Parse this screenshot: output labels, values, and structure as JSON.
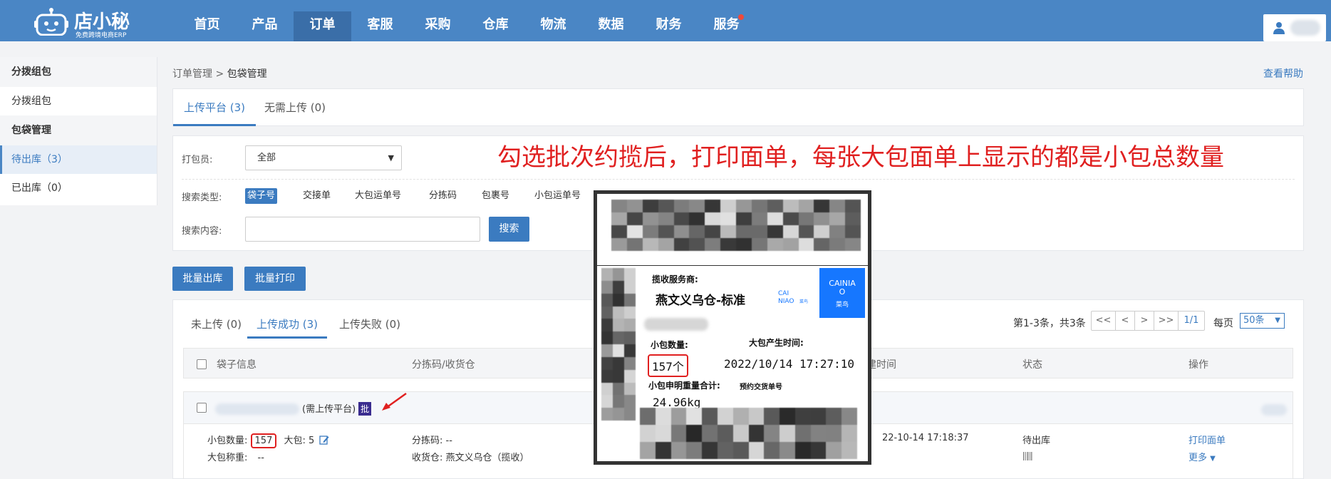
{
  "app": {
    "logo_name": "店小秘",
    "logo_sub": "免费跨境电商ERP"
  },
  "nav": {
    "items": [
      {
        "label": "首页"
      },
      {
        "label": "产品"
      },
      {
        "label": "订单",
        "active": true
      },
      {
        "label": "客服"
      },
      {
        "label": "采购"
      },
      {
        "label": "仓库"
      },
      {
        "label": "物流"
      },
      {
        "label": "数据"
      },
      {
        "label": "财务"
      },
      {
        "label": "服务",
        "dot": true
      }
    ]
  },
  "sidebar": {
    "group1": "分拨组包",
    "item1": "分拨组包",
    "group2": "包袋管理",
    "item2": "待出库（3）",
    "item3": "已出库（0）"
  },
  "breadcrumb": {
    "parent": "订单管理",
    "sep": ">",
    "current": "包袋管理"
  },
  "help": "查看帮助",
  "platform_tabs": [
    "上传平台 (3)",
    "无需上传 (0)"
  ],
  "filter": {
    "packer_label": "打包员:",
    "packer_value": "全部",
    "search_type_label": "搜索类型:",
    "search_types": [
      "袋子号",
      "交接单",
      "大包运单号",
      "分拣码",
      "包裹号",
      "小包运单号"
    ],
    "search_content_label": "搜索内容:",
    "search_button": "搜索"
  },
  "annotation": "勾选批次约揽后，打印面单，每张大包面单上显示的都是小包总数量",
  "batch": {
    "outbound": "批量出库",
    "print": "批量打印"
  },
  "list_tabs": [
    "未上传 (0)",
    "上传成功 (3)",
    "上传失败 (0)"
  ],
  "pagination": {
    "summary": "第1-3条，共3条",
    "first": "<<",
    "prev": "<",
    "next": ">",
    "last": ">>",
    "page": "1/1",
    "per_label": "每页",
    "per_value": "50条"
  },
  "table": {
    "headers": {
      "bag_info": "袋子信息",
      "sort": "分拣码/收货仓",
      "time": "建时间",
      "status": "状态",
      "actions": "操作"
    },
    "row": {
      "need_upload": "(需上传平台)",
      "batch_badge": "批",
      "small_qty_label": "小包数量:",
      "small_qty": "157",
      "big_label": "大包:",
      "big_value": "5",
      "weight_label": "大包称重:",
      "weight_value": "--",
      "sort_code": "分拣码: --",
      "warehouse": "收货仓: 燕文义乌仓（揽收）",
      "time": "22-10-14 17:18:37",
      "status": "待出库",
      "print_label": "打印面单",
      "more": "更多"
    }
  },
  "shipping_label": {
    "carrier_label": "揽收服务商:",
    "carrier_name": "燕文义乌仓-标准",
    "small_qty_label": "小包数量:",
    "small_qty": "157个",
    "created_label": "大包产生时间:",
    "created_time": "2022/10/14  17:27:10",
    "weight_label": "小包申明重量合计:",
    "weight": "24.96kg",
    "handover_label": "预约交货单号",
    "cainiao_logo": "CAINIAO",
    "cainiao_sub": "菜鸟"
  },
  "colors": {
    "nav_bg": "#4a86c5",
    "accent": "#3b7bc0",
    "annotation": "#e02020",
    "badge": "#3a2c8f",
    "cainiao": "#1677ff"
  },
  "icons": [
    "robot-logo-icon",
    "user-icon",
    "edit-icon",
    "red-arrow-icon",
    "chevron-down-icon",
    "barcode-icon",
    "cainiao-logo-icon"
  ]
}
